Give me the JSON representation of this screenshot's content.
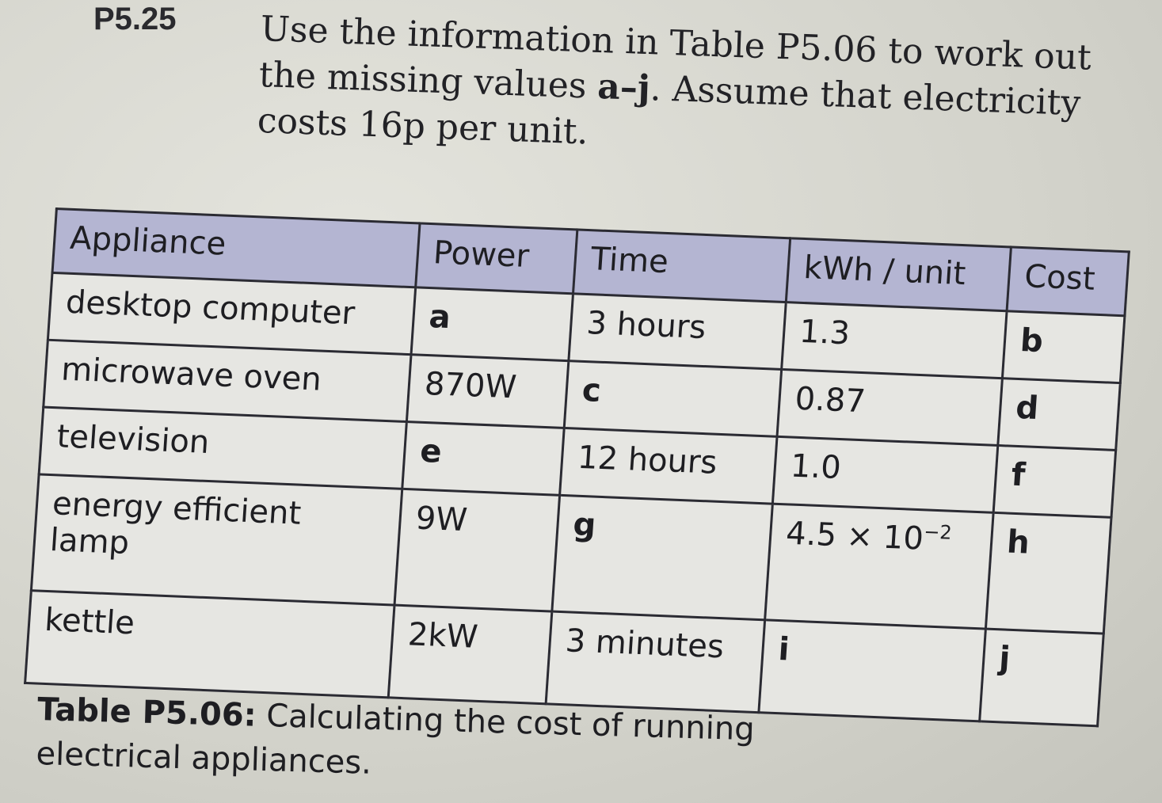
{
  "question": {
    "number": "P5.25",
    "text_before": "Use the information in Table P5.06 to work out the missing values ",
    "range": "a–j",
    "text_after": ". Assume that electricity costs 16p per unit."
  },
  "table": {
    "headers": [
      "Appliance",
      "Power",
      "Time",
      "kWh / unit",
      "Cost"
    ],
    "rows": [
      [
        "desktop computer",
        "a",
        "3 hours",
        "1.3",
        "b"
      ],
      [
        "microwave oven",
        "870W",
        "c",
        "0.87",
        "d"
      ],
      [
        "television",
        "e",
        "12 hours",
        "1.0",
        "f"
      ],
      [
        "energy efficient lamp",
        "9W",
        "g",
        "4.5 × 10",
        "h"
      ],
      [
        "kettle",
        "2kW",
        "3 minutes",
        "i",
        "j"
      ]
    ],
    "exponent": "−2",
    "header_color": "#b4b5d2"
  },
  "caption": {
    "label": "Table P5.06:",
    "text": " Calculating the cost of running electrical appliances."
  }
}
